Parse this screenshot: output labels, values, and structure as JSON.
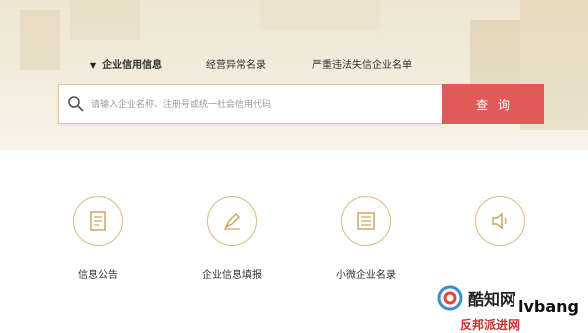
{
  "tabs": [
    {
      "label": "企业信用信息",
      "active": true
    },
    {
      "label": "经营异常名录",
      "active": false
    },
    {
      "label": "严重违法失信企业名单",
      "active": false
    }
  ],
  "search": {
    "placeholder": "请输入企业名称、注册号或统一社会信用代码",
    "button_label": "查询"
  },
  "features": [
    {
      "label": "信息公告",
      "icon": "document-icon"
    },
    {
      "label": "企业信息填报",
      "icon": "edit-pen-icon"
    },
    {
      "label": "小微企业名录",
      "icon": "list-icon"
    },
    {
      "label": "",
      "icon": "speaker-icon"
    }
  ],
  "watermark": {
    "line1": "酷知网",
    "line2": "lvbang",
    "line3": "反邦派进网"
  },
  "colors": {
    "accent_red": "#e05a58",
    "gold": "#d9b97c",
    "hero_bg": "#efe6d2"
  }
}
